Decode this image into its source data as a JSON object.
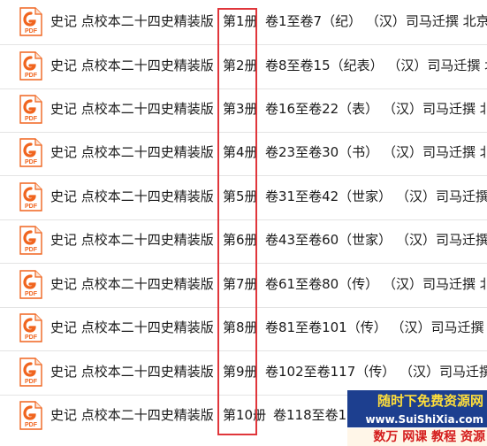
{
  "files": [
    {
      "title": "史记  点校本二十四史精装版",
      "volume": "第1册",
      "range": "卷1至卷7（纪）     （汉）司马迁撰 北京",
      "icon": "pdf-icon"
    },
    {
      "title": "史记  点校本二十四史精装版",
      "volume": "第2册",
      "range": "卷8至卷15（纪表）     （汉）司马迁撰 北",
      "icon": "pdf-icon"
    },
    {
      "title": "史记  点校本二十四史精装版",
      "volume": "第3册",
      "range": "卷16至卷22（表）     （汉）司马迁撰 北",
      "icon": "pdf-icon"
    },
    {
      "title": "史记  点校本二十四史精装版",
      "volume": "第4册",
      "range": "卷23至卷30（书）     （汉）司马迁撰 北",
      "icon": "pdf-icon"
    },
    {
      "title": "史记  点校本二十四史精装版",
      "volume": "第5册",
      "range": "卷31至卷42（世家）     （汉）司马迁撰",
      "icon": "pdf-icon"
    },
    {
      "title": "史记  点校本二十四史精装版",
      "volume": "第6册",
      "range": "卷43至卷60（世家）     （汉）司马迁撰",
      "icon": "pdf-icon"
    },
    {
      "title": "史记  点校本二十四史精装版",
      "volume": "第7册",
      "range": "卷61至卷80（传）     （汉）司马迁撰 北",
      "icon": "pdf-icon"
    },
    {
      "title": "史记  点校本二十四史精装版",
      "volume": "第8册",
      "range": "卷81至卷101（传）     （汉）司马迁撰",
      "icon": "pdf-icon"
    },
    {
      "title": "史记  点校本二十四史精装版",
      "volume": "第9册",
      "range": "卷102至卷117（传）     （汉）司马迁撰",
      "icon": "pdf-icon"
    },
    {
      "title": "史记  点校本二十四史精装版",
      "volume": "第10册",
      "range": "卷118至卷1",
      "icon": "pdf-icon"
    }
  ],
  "icon_label": "PDF",
  "watermark": {
    "line1": "随时下免费资源网",
    "line2": "www.SuiShiXia.com",
    "line3": "数万 网课 教程 资源"
  },
  "colors": {
    "highlight_box": "#e0363b",
    "pdf_icon": "#f0641e",
    "row_divider": "#e4e4e4"
  }
}
